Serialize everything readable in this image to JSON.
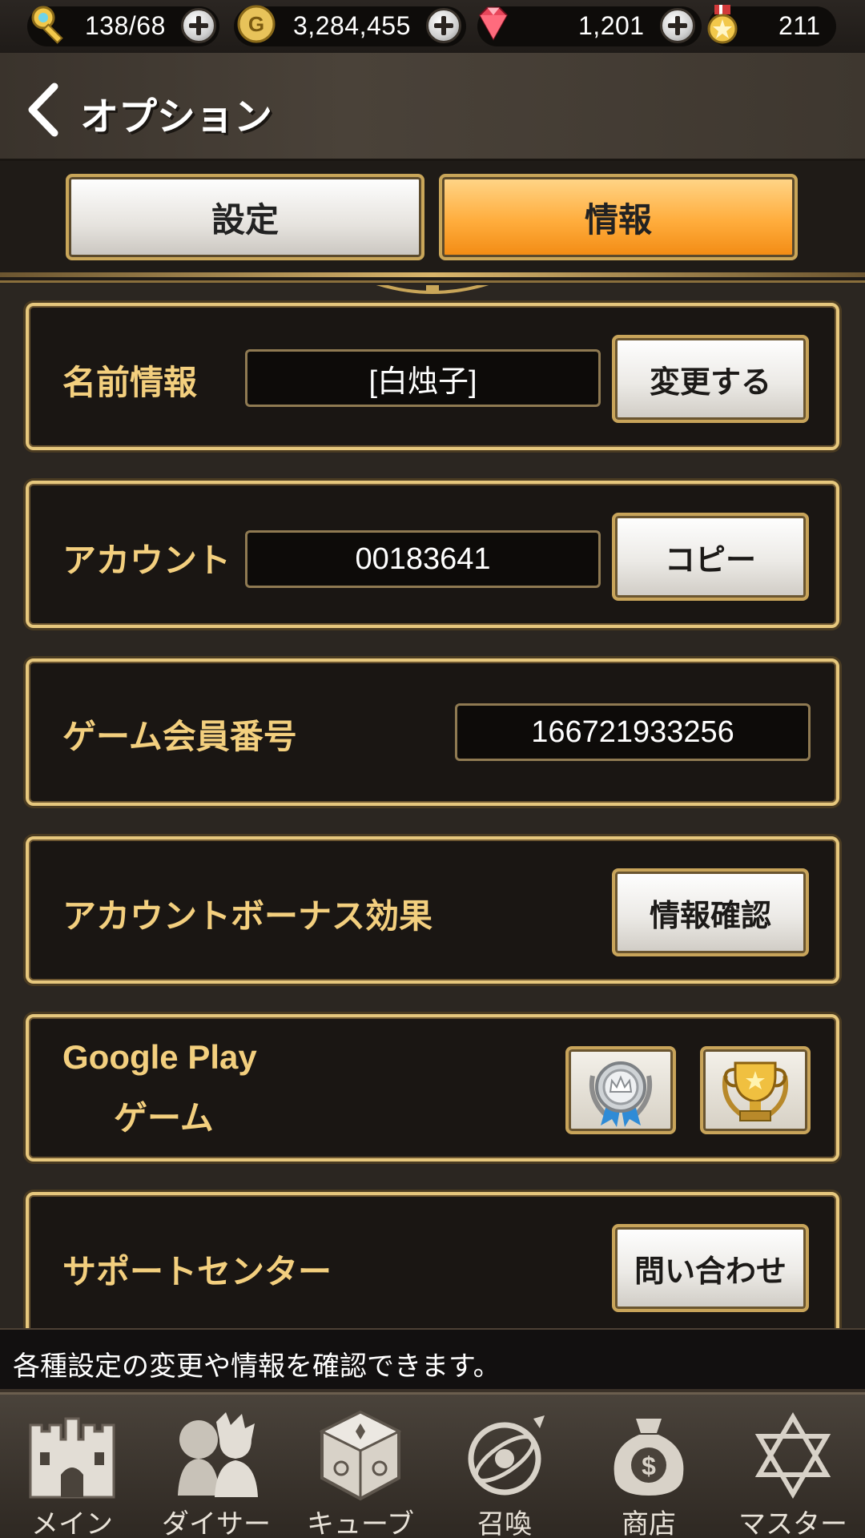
{
  "resources": {
    "keys": {
      "value": "138/68",
      "icon": "key-icon"
    },
    "gold": {
      "value": "3,284,455",
      "icon": "gold-coin-icon"
    },
    "gems": {
      "value": "1,201",
      "icon": "gem-icon"
    },
    "medals": {
      "value": "211",
      "icon": "star-medal-icon"
    }
  },
  "header": {
    "title": "オプション",
    "back_icon": "back-arrow-icon"
  },
  "tabs": [
    {
      "label": "設定",
      "active": false
    },
    {
      "label": "情報",
      "active": true
    }
  ],
  "cards": {
    "name": {
      "label": "名前情報",
      "value": "[白烛子]",
      "button": "変更する"
    },
    "account": {
      "label": "アカウント",
      "value": "00183641",
      "button": "コピー"
    },
    "member": {
      "label": "ゲーム会員番号",
      "value": "166721933256"
    },
    "bonus": {
      "label": "アカウントボーナス効果",
      "button": "情報確認"
    },
    "google": {
      "label_line1": "Google Play",
      "label_line2": "ゲーム",
      "icons": [
        "achievements-medal-icon",
        "leaderboard-trophy-icon"
      ]
    },
    "support": {
      "label": "サポートセンター",
      "button": "問い合わせ"
    }
  },
  "hint": "各種設定の変更や情報を確認できます。",
  "nav": [
    {
      "label": "メイン",
      "icon": "castle-icon"
    },
    {
      "label": "ダイサー",
      "icon": "characters-icon"
    },
    {
      "label": "キューブ",
      "icon": "cube-icon"
    },
    {
      "label": "召喚",
      "icon": "summon-icon"
    },
    {
      "label": "商店",
      "icon": "money-bag-icon"
    },
    {
      "label": "マスター",
      "icon": "hexagram-icon"
    }
  ],
  "colors": {
    "gold_text": "#f3cf7e",
    "card_border": "#e6c77d",
    "active_tab": "#ffad3d",
    "background": "#2b2621"
  }
}
